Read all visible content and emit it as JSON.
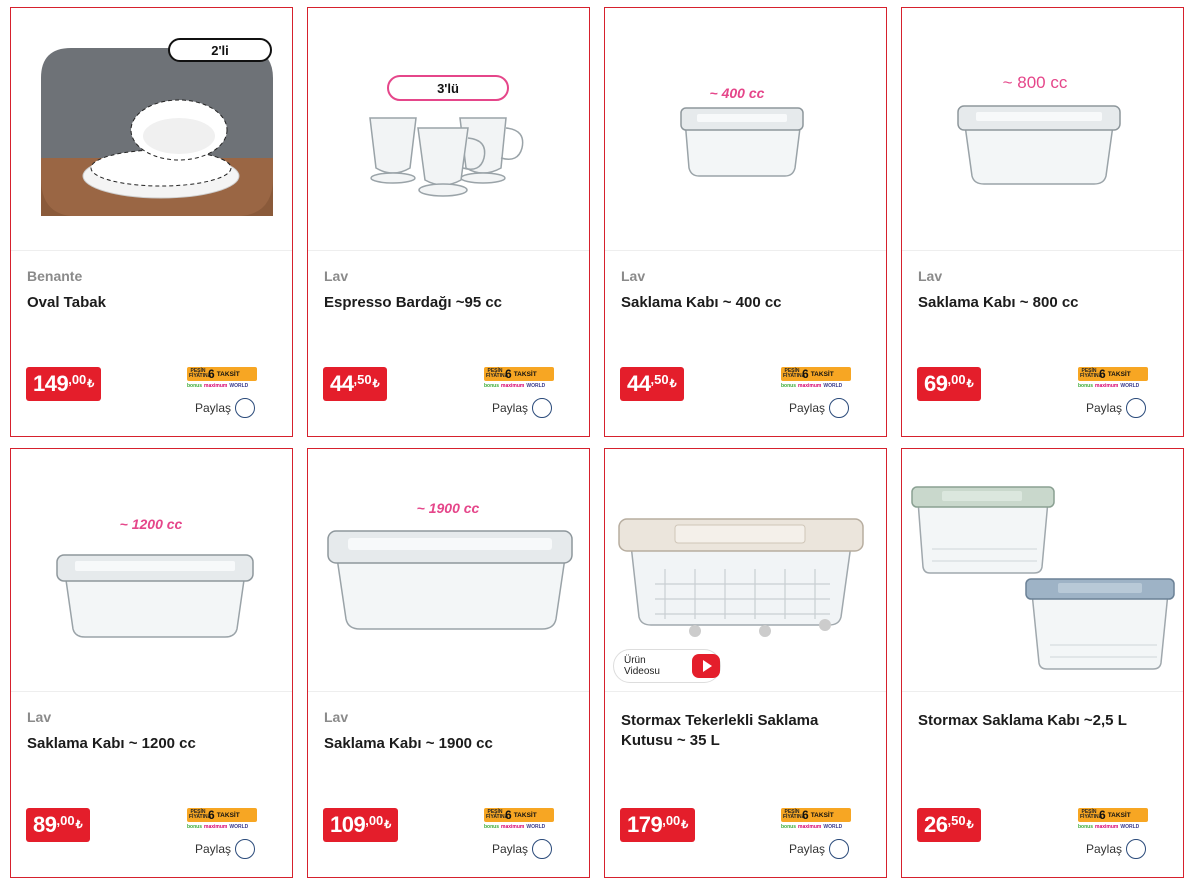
{
  "share_label": "Paylaş",
  "taksit": {
    "pesin": "PEŞİN FİYATINA",
    "count": "6",
    "label": "TAKSİT",
    "cards": [
      "bonus",
      "maximum",
      "WORLD"
    ]
  },
  "colors": {
    "accent": "#e41e2b",
    "taksit": "#f7a623",
    "border": "#d6212d"
  },
  "products": [
    {
      "brand": "Benante",
      "title": "Oval Tabak",
      "price_int": "149",
      "price_dec": ",00",
      "currency": "₺",
      "badge": "2'li"
    },
    {
      "brand": "Lav",
      "title": "Espresso Bardağı ~95 cc",
      "price_int": "44",
      "price_dec": ",50",
      "currency": "₺",
      "badge": "3'lü"
    },
    {
      "brand": "Lav",
      "title": "Saklama Kabı ~ 400 cc",
      "price_int": "44",
      "price_dec": ",50",
      "currency": "₺",
      "badge": "~ 400 cc"
    },
    {
      "brand": "Lav",
      "title": "Saklama Kabı ~ 800 cc",
      "price_int": "69",
      "price_dec": ",00",
      "currency": "₺",
      "badge": "~ 800 cc"
    },
    {
      "brand": "Lav",
      "title": "Saklama Kabı ~ 1200 cc",
      "price_int": "89",
      "price_dec": ",00",
      "currency": "₺",
      "badge": "~ 1200 cc"
    },
    {
      "brand": "Lav",
      "title": "Saklama Kabı ~ 1900 cc",
      "price_int": "109",
      "price_dec": ",00",
      "currency": "₺",
      "badge": "~ 1900 cc"
    },
    {
      "brand": "",
      "title": "Stormax Tekerlekli Saklama Kutusu ~ 35 L",
      "price_int": "179",
      "price_dec": ",00",
      "currency": "₺",
      "video_label": "Ürün Videosu"
    },
    {
      "brand": "",
      "title": "Stormax Saklama Kabı ~2,5 L",
      "price_int": "26",
      "price_dec": ",50",
      "currency": "₺"
    }
  ]
}
